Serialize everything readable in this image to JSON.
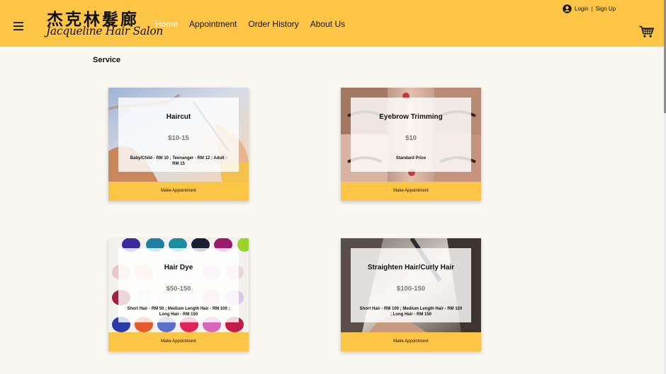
{
  "header": {
    "logo_chinese": "杰克林髮廊",
    "logo_english": "Jacqueline Hair Salon",
    "nav": [
      "Home",
      "Appointment",
      "Order History",
      "About Us"
    ],
    "active_nav": "Home",
    "login_label": "Login",
    "separator": "|",
    "signup_label": "Sign Up"
  },
  "icons": {
    "menu": "hamburger-menu-icon",
    "user": "user-circle-icon",
    "cart": "shopping-cart-icon"
  },
  "colors": {
    "accent": "#fdc545",
    "background": "#f8f7f2",
    "active_nav": "#ffffff",
    "price": "#777777"
  },
  "main": {
    "section_title": "Service",
    "services": [
      {
        "title": "Haircut",
        "price": "$10-15",
        "description": "Baby/Child - RM 10 ; Teenanger - RM 12 ; Adult - RM 15",
        "button": "Make Appointment"
      },
      {
        "title": "Eyebrow Trimming",
        "price": "$10",
        "description": "Standard Price",
        "button": "Make Appointment"
      },
      {
        "title": "Hair Dye",
        "price": "$50-150",
        "description": "Short Hair - RM 50 ; Medium Length Hair - RM 100 ; Long Hair - RM 150",
        "button": "Make Appointment"
      },
      {
        "title": "Straighten Hair/Curly Hair",
        "price": "$100-150",
        "description": "Short Hair - RM 100 ; Medium Length Hair - RM 120 ; Long Hair - RM 150",
        "button": "Make Appointment"
      }
    ]
  }
}
